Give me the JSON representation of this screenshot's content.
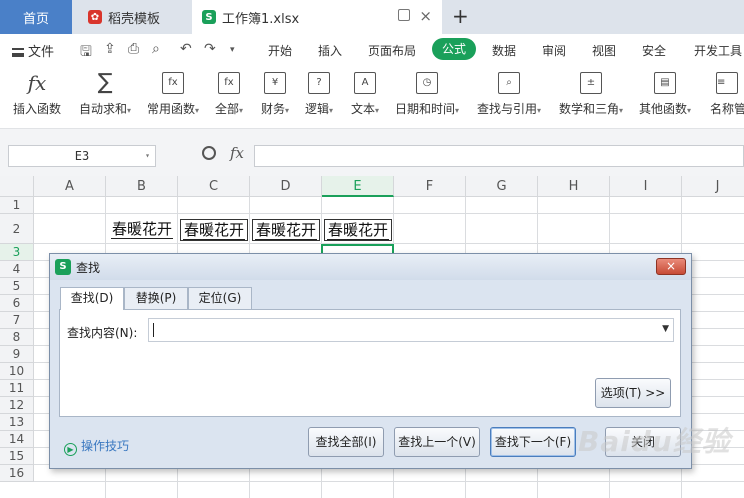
{
  "tabs": {
    "home": "首页",
    "template": "稻壳模板",
    "workbook": "工作簿1.xlsx",
    "new_tab": "+",
    "close": "×"
  },
  "menu": {
    "file": "文件",
    "items": [
      "开始",
      "插入",
      "页面布局",
      "公式",
      "数据",
      "审阅",
      "视图",
      "安全",
      "开发工具"
    ],
    "active": "公式"
  },
  "ribbon": {
    "insert_fn": "插入函数",
    "autosum": "自动求和",
    "common_fn": "常用函数",
    "all": "全部",
    "finance": "财务",
    "logic": "逻辑",
    "text": "文本",
    "datetime": "日期和时间",
    "lookup": "查找与引用",
    "math": "数学和三角",
    "other": "其他函数",
    "name_mgr": "名称管",
    "fx_glyph": "fx",
    "sum_glyph": "∑"
  },
  "formula_bar": {
    "cell_ref": "E3",
    "fx": "fx",
    "content": ""
  },
  "sheet": {
    "columns": [
      "A",
      "B",
      "C",
      "D",
      "E",
      "F",
      "G",
      "H",
      "I",
      "J"
    ],
    "active_column": "E",
    "rows": [
      "1",
      "2",
      "3",
      "4",
      "5",
      "6",
      "7",
      "8",
      "9",
      "10",
      "11",
      "12",
      "13",
      "14",
      "15",
      "16"
    ],
    "active_row": "3",
    "row2": [
      "春暖花开",
      "春暖花开",
      "春暖花开",
      "春暖花开"
    ]
  },
  "dialog": {
    "title": "查找",
    "close": "×",
    "tabs": [
      "查找(D)",
      "替换(P)",
      "定位(G)"
    ],
    "active_tab": "查找(D)",
    "find_label": "查找内容(N):",
    "find_value": "",
    "options_button": "选项(T) >>",
    "find_all": "查找全部(I)",
    "find_prev": "查找上一个(V)",
    "find_next": "查找下一个(F)",
    "close_button": "关闭",
    "tips": "操作技巧"
  },
  "watermark": "Baidu经验",
  "colors": {
    "accent": "#1aa05a",
    "home_tab": "#4a80c8",
    "dialog_bg": "#dbe4f0"
  }
}
